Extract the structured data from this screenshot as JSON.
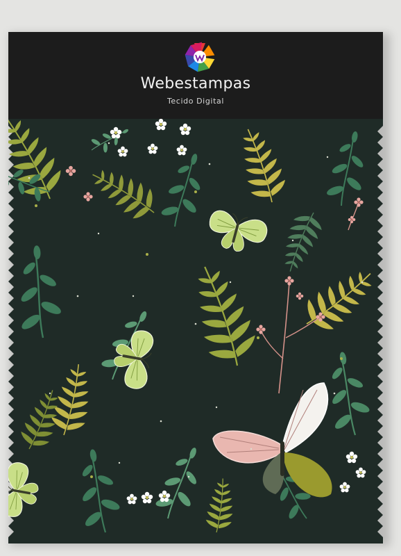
{
  "brand": {
    "name": "Webestampas",
    "tagline": "Tecido Digital",
    "logo_colors": [
      "#e53935",
      "#fb8c00",
      "#fdd835",
      "#43a047",
      "#1e88e5",
      "#8e24aa"
    ]
  },
  "fabric": {
    "pattern": "botanical-ferns-butterflies",
    "background_color": "#1f2b27",
    "leaf_colors": [
      "#3d7a5a",
      "#5c9a74",
      "#9aa83f",
      "#7f8f34",
      "#c3b74a"
    ],
    "butterfly_colors": [
      "#c9df88",
      "#e9b7b0",
      "#f4f2ee",
      "#9a9a2e"
    ],
    "flower_colors": [
      "#ffffff",
      "#e8a6a0"
    ]
  }
}
